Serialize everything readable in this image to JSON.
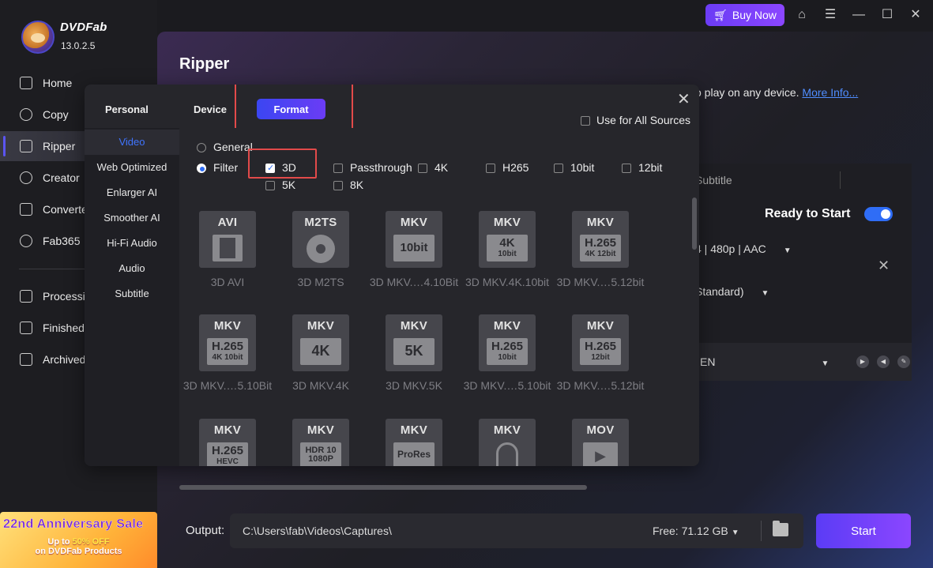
{
  "app": {
    "brand": "DVDFab",
    "version": "13.0.2.5"
  },
  "sidebar": {
    "items": [
      {
        "label": "Home",
        "icon": "home-icon"
      },
      {
        "label": "Copy",
        "icon": "copy-icon"
      },
      {
        "label": "Ripper",
        "icon": "ripper-icon",
        "active": true
      },
      {
        "label": "Creator",
        "icon": "creator-icon"
      },
      {
        "label": "Converte",
        "icon": "converter-icon"
      },
      {
        "label": "Fab365",
        "icon": "fab365-icon"
      },
      {
        "label": "Processi",
        "icon": "processing-icon"
      },
      {
        "label": "Finished",
        "icon": "finished-icon"
      },
      {
        "label": "Archived",
        "icon": "archived-icon"
      }
    ],
    "promo": {
      "title": "22nd Anniversary Sale",
      "line1_prefix": "Up to ",
      "line1_highlight": "50% OFF",
      "line2": "on DVDFab Products"
    }
  },
  "titlebar": {
    "buy_now": "Buy Now"
  },
  "page": {
    "title": "Ripper",
    "info_text": "o play on any device.",
    "info_link": "More Info..."
  },
  "background_panel": {
    "subtitle_tab": "Subtitle",
    "ready_label": "Ready to Start",
    "profile": "4 | 480p | AAC",
    "quality": "Standard)",
    "language": "EN"
  },
  "modal": {
    "tabs": [
      "Personal",
      "Device",
      "Format"
    ],
    "use_all_sources": "Use for All Sources",
    "categories": [
      "Video",
      "Web Optimized",
      "Enlarger AI",
      "Smoother AI",
      "Hi-Fi Audio",
      "Audio",
      "Subtitle"
    ],
    "mode_general": "General",
    "mode_filter": "Filter",
    "filters": [
      {
        "label": "3D",
        "checked": true
      },
      {
        "label": "Passthrough",
        "checked": false
      },
      {
        "label": "4K",
        "checked": false
      },
      {
        "label": "H265",
        "checked": false
      },
      {
        "label": "10bit",
        "checked": false
      },
      {
        "label": "12bit",
        "checked": false
      },
      {
        "label": "5K",
        "checked": false
      },
      {
        "label": "8K",
        "checked": false
      }
    ],
    "formats": [
      {
        "top": "AVI",
        "art": "film",
        "label": "3D AVI"
      },
      {
        "top": "M2TS",
        "art": "reel",
        "label": "3D M2TS"
      },
      {
        "top": "MKV",
        "sub_big": "10bit",
        "sub_small": "",
        "label": "3D MKV.…4.10Bit"
      },
      {
        "top": "MKV",
        "sub_big": "4K",
        "sub_small": "10bit",
        "label": "3D MKV.4K.10bit"
      },
      {
        "top": "MKV",
        "sub_big": "H.265",
        "sub_small": "4K 12bit",
        "label": "3D MKV.…5.12bit"
      },
      {
        "top": "MKV",
        "sub_big": "H.265",
        "sub_small": "4K 10bit",
        "label": "3D MKV.…5.10Bit"
      },
      {
        "top": "MKV",
        "sub_big": "4K",
        "sub_small": "",
        "label": "3D MKV.4K"
      },
      {
        "top": "MKV",
        "sub_big": "5K",
        "sub_small": "",
        "label": "3D MKV.5K"
      },
      {
        "top": "MKV",
        "sub_big": "H.265",
        "sub_small": "10bit",
        "label": "3D MKV.…5.10bit"
      },
      {
        "top": "MKV",
        "sub_big": "H.265",
        "sub_small": "12bit",
        "label": "3D MKV.…5.12bit"
      },
      {
        "top": "MKV",
        "sub_big": "H.265",
        "sub_small": "HEVC",
        "label": ""
      },
      {
        "top": "MKV",
        "sub_big": "HDR 10",
        "sub_small": "1080P",
        "label": ""
      },
      {
        "top": "MKV",
        "sub_big": "ProRes",
        "sub_small": "",
        "label": ""
      },
      {
        "top": "MKV",
        "art": "head",
        "label": ""
      },
      {
        "top": "MOV",
        "art": "play",
        "label": ""
      }
    ]
  },
  "footer": {
    "output_label": "Output:",
    "output_path": "C:\\Users\\fab\\Videos\\Captures\\",
    "free_space": "Free: 71.12 GB",
    "start": "Start"
  }
}
